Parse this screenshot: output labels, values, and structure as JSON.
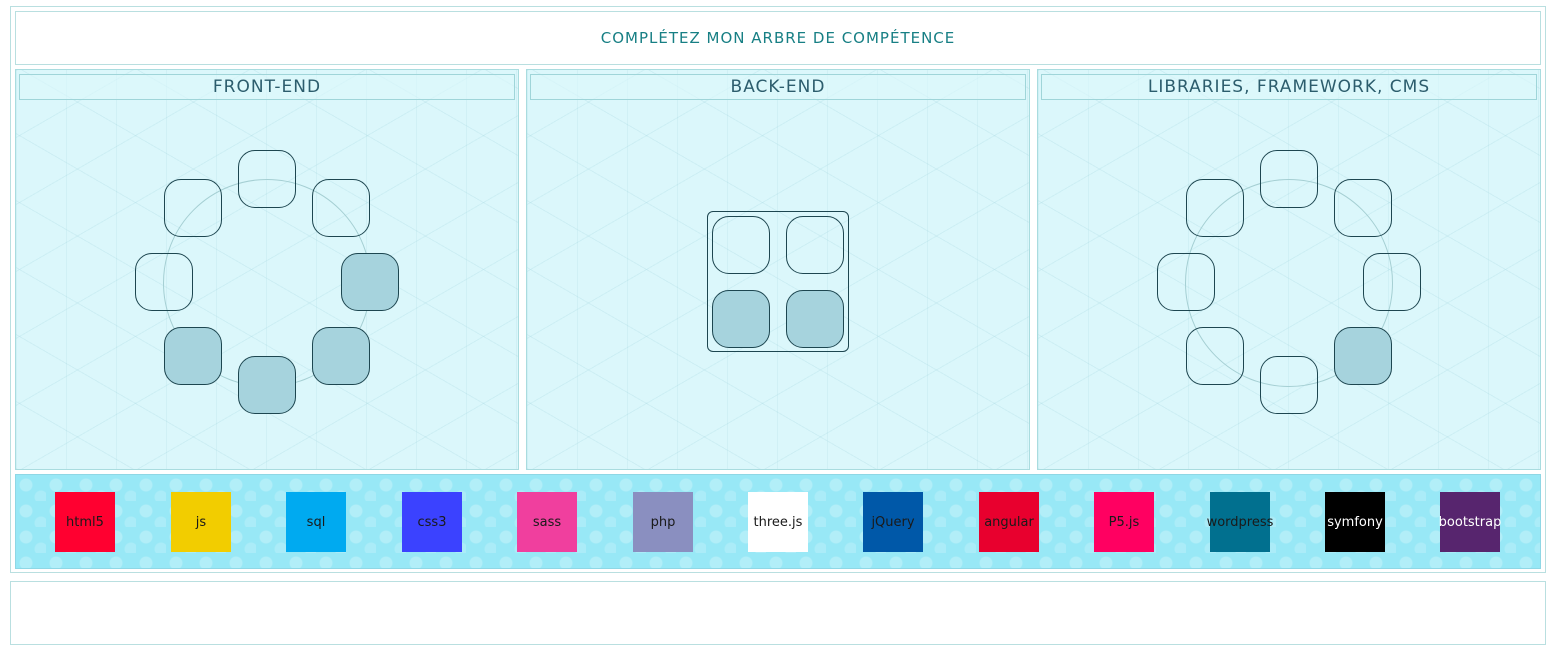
{
  "title": "COMPLÉTEZ MON ARBRE DE COMPÉTENCE",
  "panels": [
    {
      "label": "FRONT-END",
      "slots_filled": [
        false,
        false,
        false,
        true,
        true,
        true,
        true,
        false
      ]
    },
    {
      "label": "BACK-END",
      "slots_filled": [
        false,
        false,
        true,
        true
      ]
    },
    {
      "label": "LIBRARIES, FRAMEWORK, CMS",
      "slots_filled": [
        false,
        false,
        false,
        false,
        true,
        false,
        false,
        false
      ]
    }
  ],
  "tiles": [
    {
      "label": "html5",
      "bg": "#ff0030",
      "color": "#1a1a1a"
    },
    {
      "label": "js",
      "bg": "#f2cd00",
      "color": "#1a1a1a"
    },
    {
      "label": "sql",
      "bg": "#00aaf0",
      "color": "#1a1a1a"
    },
    {
      "label": "css3",
      "bg": "#3b42ff",
      "color": "#1a1a1a"
    },
    {
      "label": "sass",
      "bg": "#f03f9e",
      "color": "#1a1a1a"
    },
    {
      "label": "php",
      "bg": "#8a8fc0",
      "color": "#1a1a1a"
    },
    {
      "label": "three.js",
      "bg": "#ffffff",
      "color": "#1a1a1a"
    },
    {
      "label": "jQuery",
      "bg": "#0058a8",
      "color": "#1a1a1a"
    },
    {
      "label": "angular",
      "bg": "#e8002e",
      "color": "#1a1a1a"
    },
    {
      "label": "P5.js",
      "bg": "#ff0061",
      "color": "#1a1a1a"
    },
    {
      "label": "wordpress",
      "bg": "#01708f",
      "color": "#1a1a1a"
    },
    {
      "label": "symfony",
      "bg": "#000000",
      "color": "#ffffff"
    },
    {
      "label": "bootstrap",
      "bg": "#57256e",
      "color": "#ffffff"
    }
  ]
}
